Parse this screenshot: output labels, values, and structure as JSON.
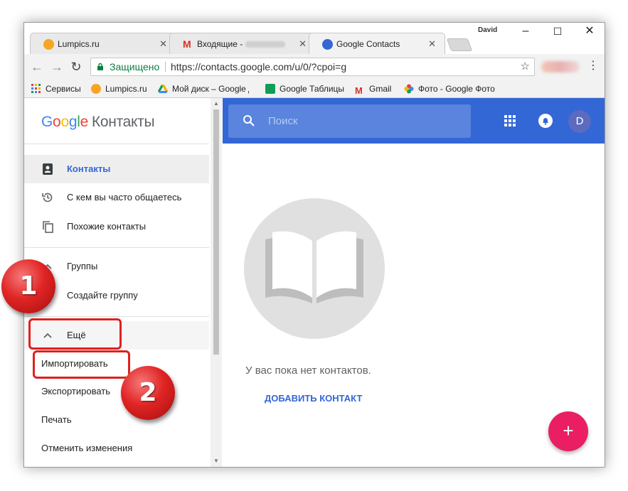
{
  "browser": {
    "user": "David",
    "tabs": [
      {
        "title": "Lumpics.ru"
      },
      {
        "title": "Входящие -"
      },
      {
        "title": "Google Contacts"
      }
    ],
    "address": {
      "secure_label": "Защищено",
      "url": "https://contacts.google.com/u/0/?cpoi=g"
    },
    "bookmarks": [
      {
        "label": "Сервисы"
      },
      {
        "label": "Lumpics.ru"
      },
      {
        "label": "Мой диск – Google Д"
      },
      {
        "label": "Google Таблицы"
      },
      {
        "label": "Gmail"
      },
      {
        "label": "Фото - Google Фото"
      }
    ]
  },
  "app": {
    "logo_google": "Google",
    "logo_product": "Контакты",
    "search_placeholder": "Поиск",
    "avatar_letter": "D"
  },
  "sidebar": {
    "contacts": "Контакты",
    "frequent": "С кем вы часто общаетесь",
    "duplicates": "Похожие контакты",
    "groups": "Группы",
    "create_group": "Создайте группу",
    "more": "Ещё",
    "import": "Импортировать",
    "export": "Экспортировать",
    "print": "Печать",
    "undo": "Отменить изменения"
  },
  "main": {
    "empty_text": "У вас пока нет контактов.",
    "add_contact": "ДОБАВИТЬ КОНТАКТ",
    "fab": "+"
  },
  "callouts": {
    "one": "1",
    "two": "2"
  },
  "colors": {
    "accent": "#3367d6",
    "fab": "#e91e63",
    "callout": "#e02020"
  }
}
